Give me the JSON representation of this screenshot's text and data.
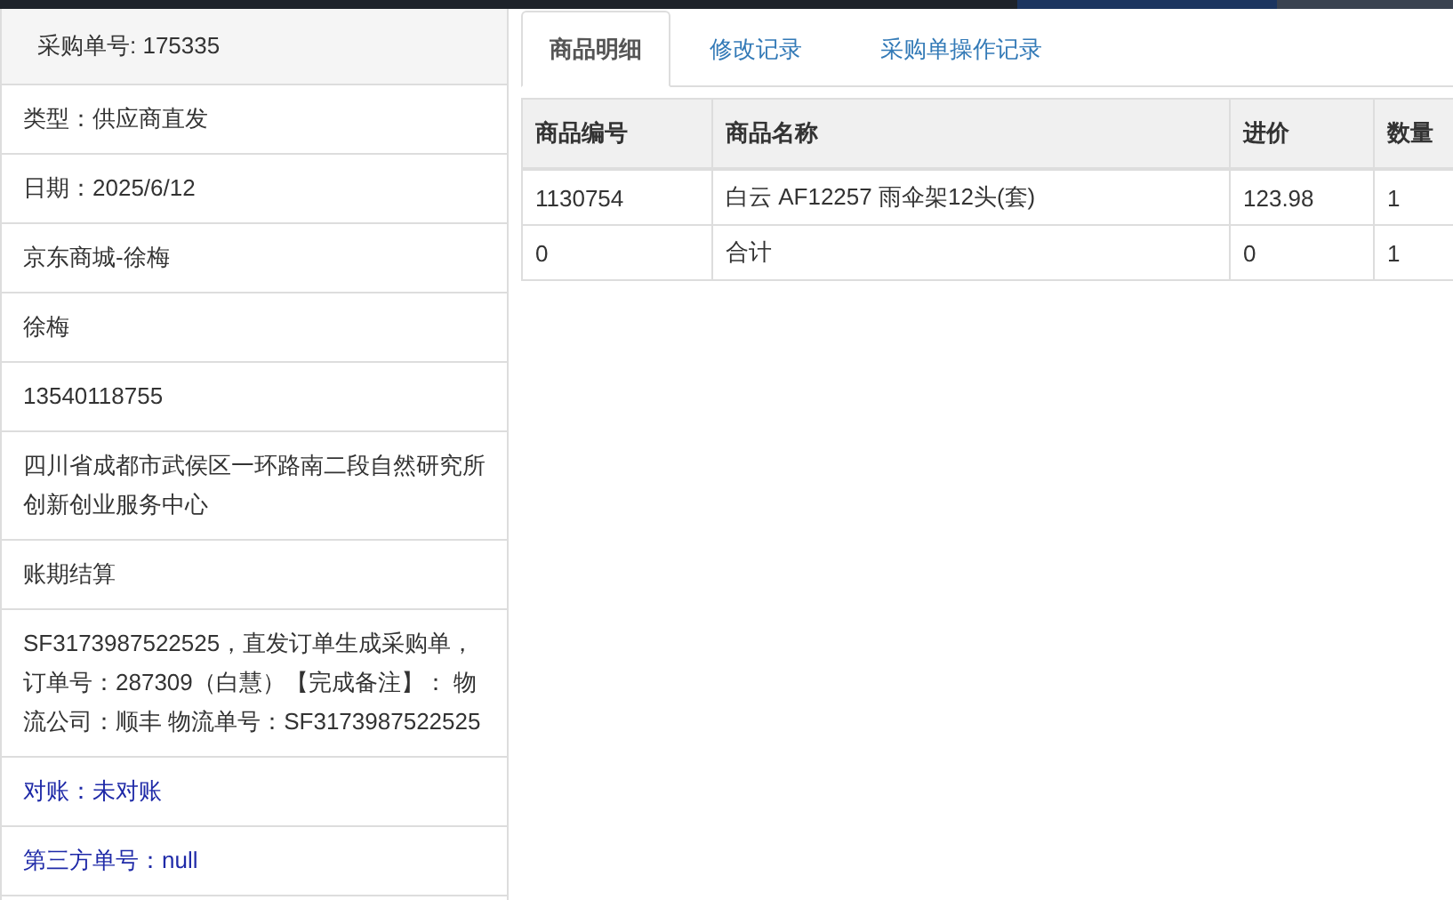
{
  "order_panel": {
    "title": "采购单号: 175335",
    "items": [
      {
        "kind": "text",
        "text": "类型：供应商直发"
      },
      {
        "kind": "text",
        "text": "日期：2025/6/12"
      },
      {
        "kind": "text",
        "text": "京东商城-徐梅"
      },
      {
        "kind": "text",
        "text": "徐梅"
      },
      {
        "kind": "text",
        "text": "13540118755"
      },
      {
        "kind": "text",
        "text": "四川省成都市武侯区一环路南二段自然研究所创新创业服务中心"
      },
      {
        "kind": "text",
        "text": "账期结算"
      },
      {
        "kind": "text",
        "text": "SF3173987522525，直发订单生成采购单，订单号：287309（白慧）【完成备注】： 物流公司：顺丰 物流单号：SF3173987522525"
      },
      {
        "kind": "accent",
        "text": "对账：未对账"
      },
      {
        "kind": "accent",
        "text": "第三方单号：null"
      }
    ]
  },
  "tabs": [
    {
      "label": "商品明细",
      "selected": true
    },
    {
      "label": "修改记录",
      "selected": false
    },
    {
      "label": "采购单操作记录",
      "selected": false
    }
  ],
  "table": {
    "columns": [
      "商品编号",
      "商品名称",
      "进价",
      "数量"
    ],
    "rows": [
      [
        "1130754",
        "白云 AF12257 雨伞架12头(套)",
        "123.98",
        "1"
      ],
      [
        "0",
        "合计",
        "0",
        "1"
      ]
    ]
  }
}
